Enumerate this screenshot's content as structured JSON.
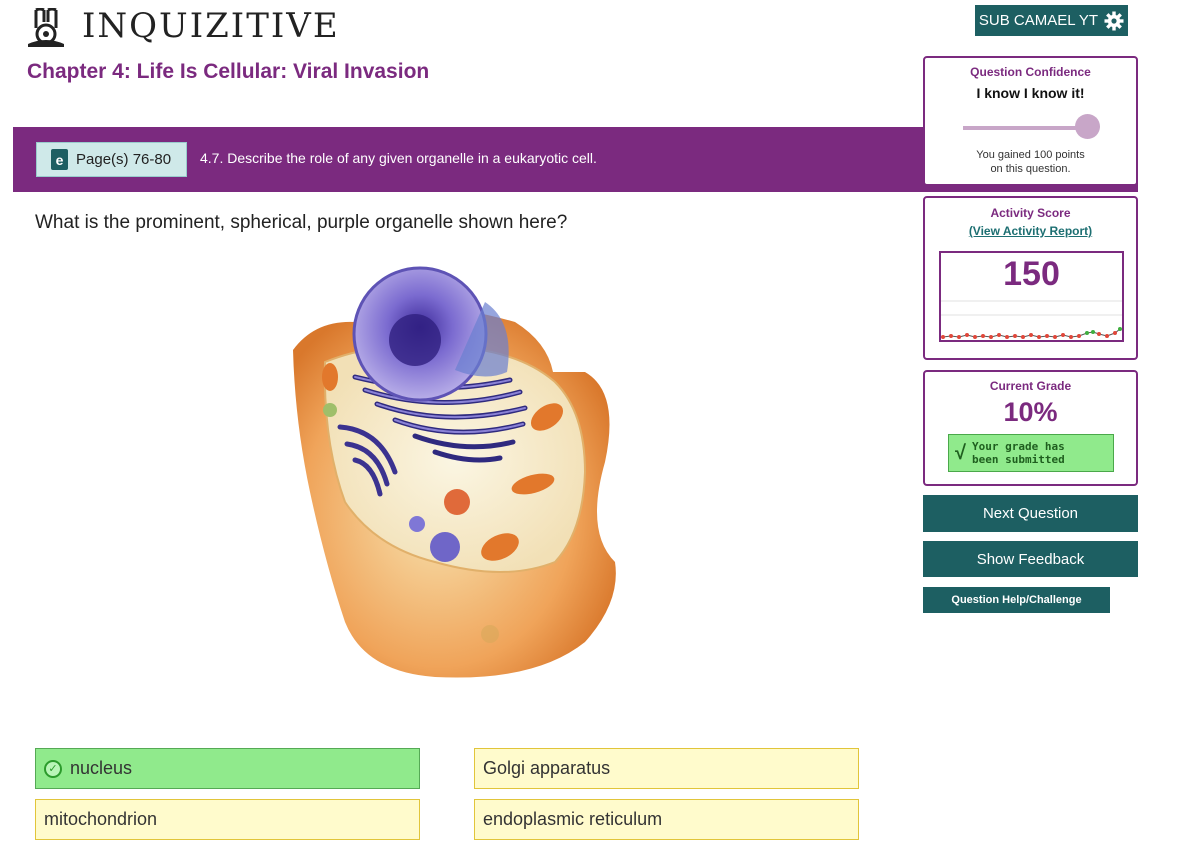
{
  "app": {
    "name": "INQUIZITIVE"
  },
  "user": {
    "label": "SUB CAMAEL YT"
  },
  "chapter": {
    "title": "Chapter 4: Life Is Cellular: Viral Invasion"
  },
  "objective": {
    "pages": "Page(s) 76-80",
    "text": "4.7. Describe the role of any given organelle in a eukaryotic cell."
  },
  "question": {
    "prompt": "What is the prominent, spherical, purple organelle shown here?"
  },
  "answers": [
    {
      "label": "nucleus",
      "state": "correct"
    },
    {
      "label": "Golgi apparatus",
      "state": "unselected"
    },
    {
      "label": "mitochondrion",
      "state": "unselected"
    },
    {
      "label": "endoplasmic reticulum",
      "state": "unselected"
    }
  ],
  "confidence": {
    "title": "Question Confidence",
    "label": "I know I know it!",
    "level": 1.0,
    "message_line1": "You gained 100 points",
    "message_line2": "on this question."
  },
  "activity": {
    "title": "Activity Score",
    "report_link": "(View Activity Report)",
    "score": "150"
  },
  "grade": {
    "title": "Current Grade",
    "value": "10%",
    "submitted_line1": "Your grade has",
    "submitted_line2": "been submitted"
  },
  "buttons": {
    "next": "Next Question",
    "feedback": "Show Feedback",
    "help": "Question Help/Challenge"
  },
  "colors": {
    "brand_purple": "#7b2a7f",
    "teal": "#1d5f62",
    "correct_green": "#90ea8c",
    "answer_yellow": "#fffbcc"
  }
}
